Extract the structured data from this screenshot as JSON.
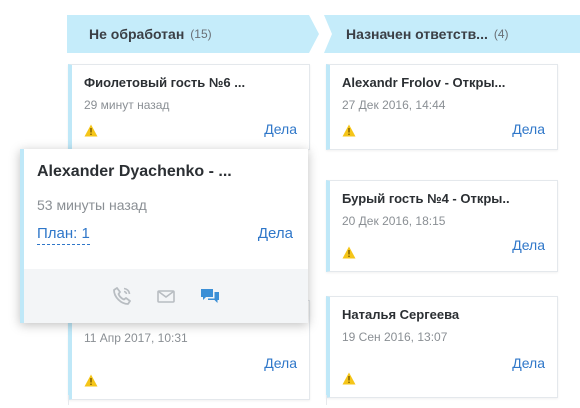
{
  "columns": [
    {
      "title": "Не обработан",
      "count": "(15)",
      "cards": [
        {
          "title": "Фиолетовый гость №6 ...",
          "date": "29 минут назад",
          "deals": "Дела"
        },
        {
          "title": "",
          "date": "11 Апр 2017, 10:31",
          "deals": "Дела"
        }
      ]
    },
    {
      "title": "Назначен ответств...",
      "count": "(4)",
      "cards": [
        {
          "title": "Alexandr Frolov - Откры...",
          "date": "27 Дек 2016, 14:44",
          "deals": "Дела"
        },
        {
          "title": "Бурый гость №4 - Откры..",
          "date": "20 Дек 2016, 18:15",
          "deals": "Дела"
        },
        {
          "title": "Наталья Сергеева",
          "date": "19 Сен 2016, 13:07",
          "deals": "Дела"
        }
      ]
    }
  ],
  "popup": {
    "title": "Alexander Dyachenko - ...",
    "time": "53 минуты назад",
    "plan": "План: 1",
    "deals": "Дела",
    "actions": [
      "phone-icon",
      "mail-icon",
      "chat-icon"
    ]
  },
  "colors": {
    "header_bg": "#c5ecfa",
    "link": "#2f77c9",
    "card_accent": "#bfe8f8",
    "warning": "#f5c518",
    "chat_active": "#3b8fd6",
    "icon_muted": "#b8bdc2"
  }
}
